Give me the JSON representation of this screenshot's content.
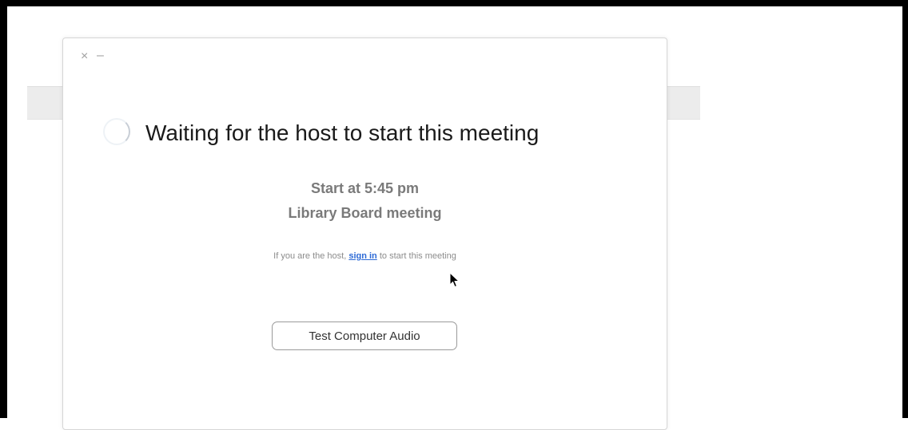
{
  "window": {
    "close_label": "×",
    "minimize_label": "–",
    "title": "Waiting for the host to start this meeting",
    "start_time": "Start at 5:45 pm",
    "meeting_name": "Library Board meeting",
    "host_prompt_prefix": "If you are the host, ",
    "sign_in_link": "sign in",
    "host_prompt_suffix": " to start this meeting",
    "test_audio_button": "Test Computer Audio"
  },
  "icons": {
    "spinner": "loading-spinner-icon",
    "cursor": "mouse-pointer-icon"
  },
  "colors": {
    "link": "#2d6ad6",
    "subtitle": "#7a7a7a",
    "title": "#1a1a1a"
  }
}
